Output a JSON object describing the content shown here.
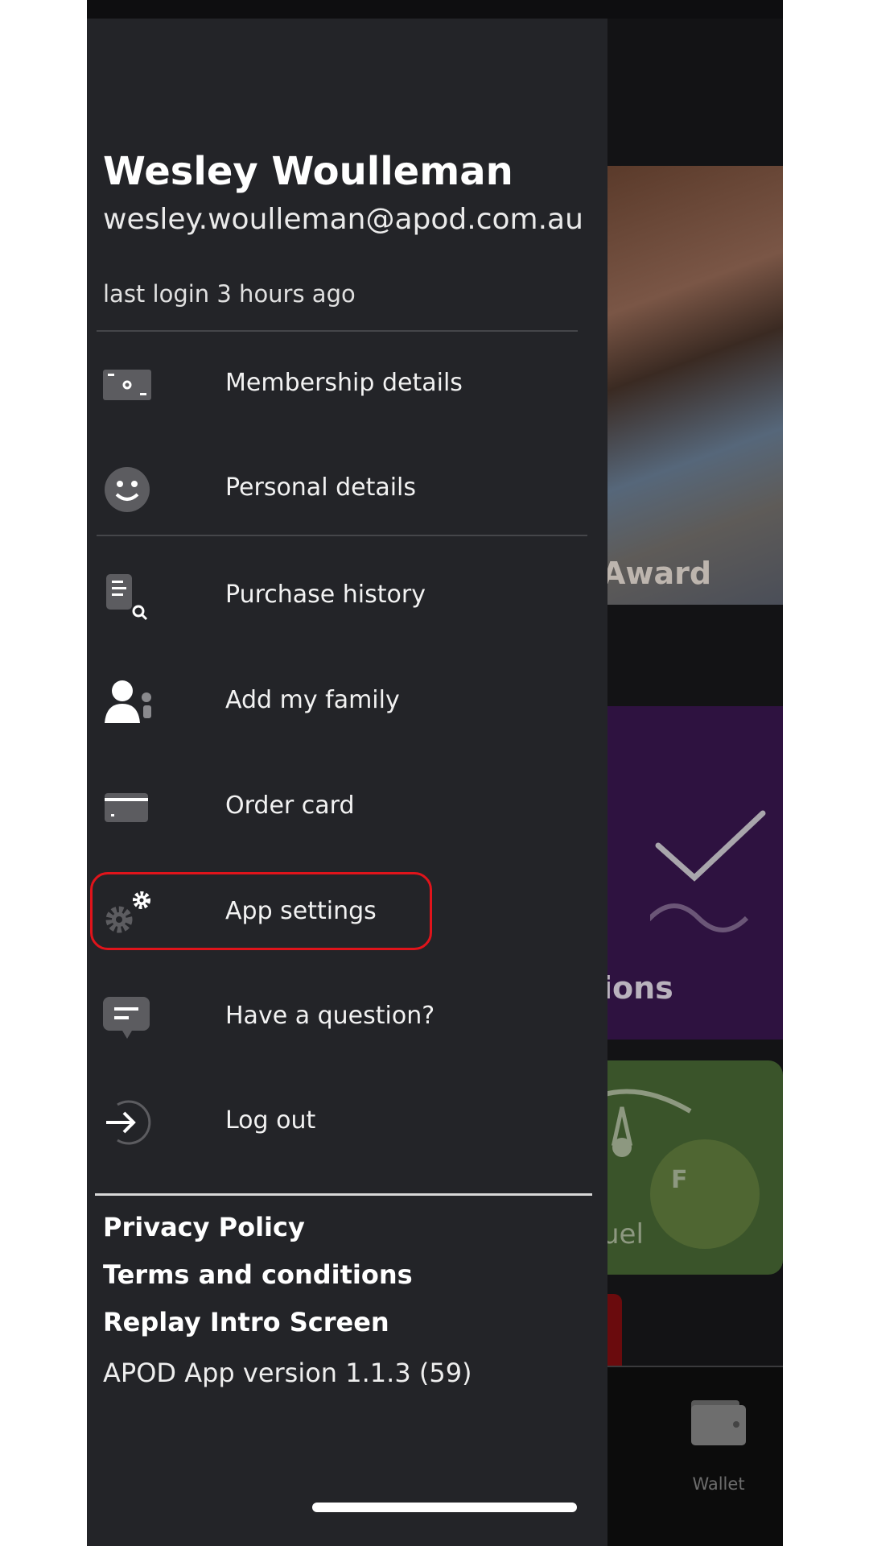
{
  "user": {
    "name": "Wesley Woulleman",
    "email": "wesley.woulleman@apod.com.au",
    "last_login": "last login 3 hours ago"
  },
  "menu": {
    "items": [
      {
        "label": "Membership details",
        "icon": "membership-card-icon"
      },
      {
        "label": "Personal details",
        "icon": "smiley-face-icon"
      },
      {
        "label": "Purchase history",
        "icon": "receipt-search-icon"
      },
      {
        "label": "Add my family",
        "icon": "add-family-icon"
      },
      {
        "label": "Order card",
        "icon": "credit-card-icon"
      },
      {
        "label": "App settings",
        "icon": "gears-icon",
        "highlighted": true
      },
      {
        "label": "Have a question?",
        "icon": "chat-bubble-icon"
      },
      {
        "label": "Log out",
        "icon": "logout-icon"
      }
    ]
  },
  "footer": {
    "privacy": "Privacy Policy",
    "terms": "Terms and conditions",
    "replay": "Replay Intro Screen",
    "version": "APOD App version 1.1.3 (59)"
  },
  "background": {
    "award_text": "Award",
    "ions_text": "ions",
    "fuel_text": "uel",
    "fuel_badge": "F",
    "nav_wallet": "Wallet"
  },
  "colors": {
    "drawer": "#232428",
    "highlight": "#e0141b",
    "purple_card": "#2e1240",
    "green_card": "#3a542a"
  }
}
